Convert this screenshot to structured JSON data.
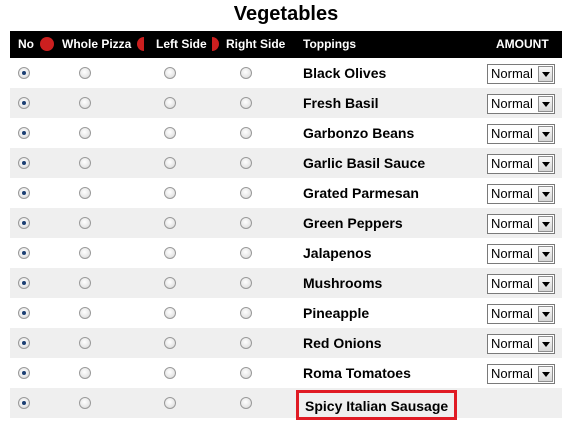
{
  "title": "Vegetables",
  "header": {
    "no": "No",
    "whole": "Whole Pizza",
    "left": "Left Side",
    "right": "Right Side",
    "toppings": "Toppings",
    "amount": "AMOUNT"
  },
  "accent_color": "#cc1f1f",
  "highlight_color": "#e01b24",
  "rows": [
    {
      "name": "Black Olives",
      "selected": "no",
      "amount": "Normal"
    },
    {
      "name": "Fresh Basil",
      "selected": "no",
      "amount": "Normal"
    },
    {
      "name": "Garbonzo Beans",
      "selected": "no",
      "amount": "Normal"
    },
    {
      "name": "Garlic Basil Sauce",
      "selected": "no",
      "amount": "Normal"
    },
    {
      "name": "Grated Parmesan",
      "selected": "no",
      "amount": "Normal"
    },
    {
      "name": "Green Peppers",
      "selected": "no",
      "amount": "Normal"
    },
    {
      "name": "Jalapenos",
      "selected": "no",
      "amount": "Normal"
    },
    {
      "name": "Mushrooms",
      "selected": "no",
      "amount": "Normal"
    },
    {
      "name": "Pineapple",
      "selected": "no",
      "amount": "Normal"
    },
    {
      "name": "Red Onions",
      "selected": "no",
      "amount": "Normal"
    },
    {
      "name": "Roma Tomatoes",
      "selected": "no",
      "amount": "Normal"
    },
    {
      "name": "Spicy Italian Sausage",
      "selected": "no",
      "amount": "",
      "highlighted": true
    }
  ]
}
